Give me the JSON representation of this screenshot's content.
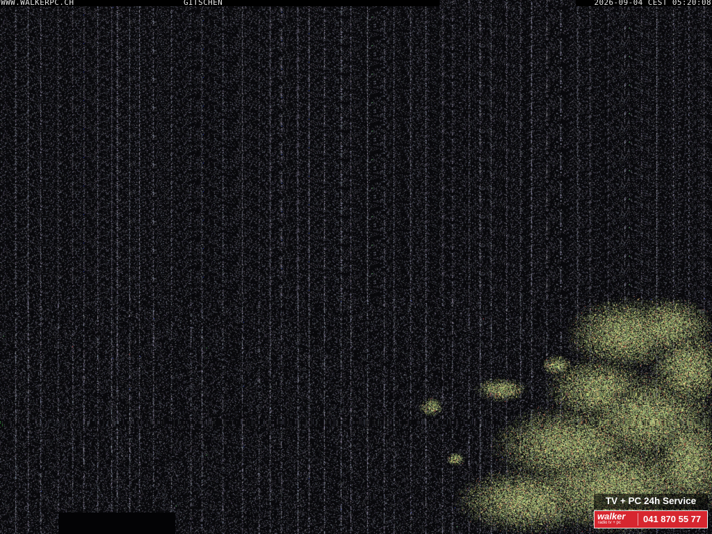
{
  "overlay": {
    "site": "WWW.WALKERPC.CH",
    "location": "GITSCHEN",
    "timestamp": "2026-09-04 CEST 05:20:08"
  },
  "ad": {
    "service_line": "TV + PC 24h Service",
    "brand": "walker",
    "brand_sub": "radio tv + pc",
    "phone": "041 870 55 77",
    "brand_color": "#d7262f"
  }
}
